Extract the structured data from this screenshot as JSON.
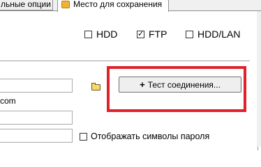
{
  "tabs": [
    {
      "label": "льные опции",
      "active": false
    },
    {
      "label": "Место для сохранения",
      "active": true,
      "icon": "folder-icon"
    }
  ],
  "storage_options": [
    {
      "label": "HDD",
      "checked": false
    },
    {
      "label": "FTP",
      "checked": true
    },
    {
      "label": "HDD/LAN",
      "checked": false
    }
  ],
  "fields": {
    "server_value": "",
    "login_value": "",
    "password_value": "",
    "partial_text": "com"
  },
  "test_button": {
    "label": "Тест соединения...",
    "icon": "plus-icon"
  },
  "show_password": {
    "label": "Отображать символы пароля",
    "checked": false
  },
  "colors": {
    "highlight": "#e0202a",
    "tab_icon": "#f2b234"
  }
}
